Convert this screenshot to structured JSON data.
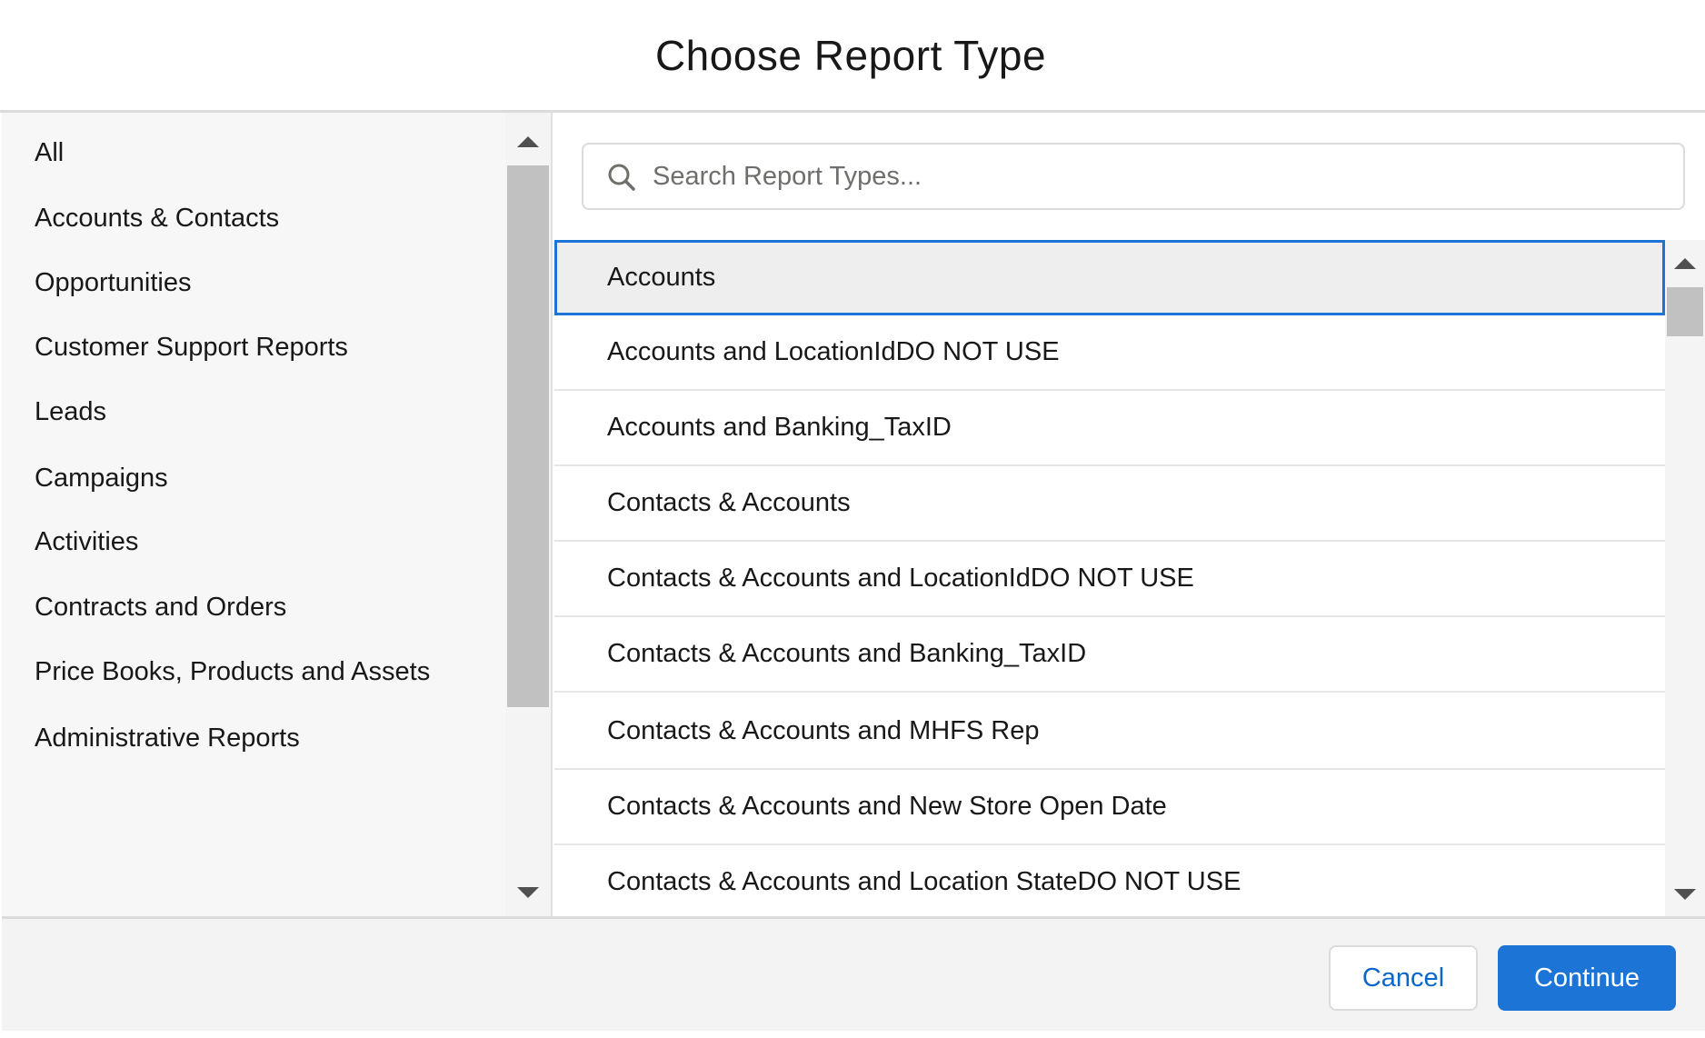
{
  "dialog": {
    "title": "Choose Report Type"
  },
  "categories": [
    {
      "label": "All"
    },
    {
      "label": "Accounts & Contacts"
    },
    {
      "label": "Opportunities"
    },
    {
      "label": "Customer Support Reports"
    },
    {
      "label": "Leads"
    },
    {
      "label": "Campaigns"
    },
    {
      "label": "Activities"
    },
    {
      "label": "Contracts and Orders"
    },
    {
      "label": "Price Books, Products and Assets"
    },
    {
      "label": "Administrative Reports"
    }
  ],
  "search": {
    "placeholder": "Search Report Types...",
    "value": ""
  },
  "report_types": [
    {
      "label": "Accounts",
      "selected": true
    },
    {
      "label": "Accounts and LocationIdDO NOT USE"
    },
    {
      "label": "Accounts and Banking_TaxID"
    },
    {
      "label": "Contacts & Accounts"
    },
    {
      "label": "Contacts & Accounts and LocationIdDO NOT USE"
    },
    {
      "label": "Contacts & Accounts and Banking_TaxID"
    },
    {
      "label": "Contacts & Accounts and MHFS Rep"
    },
    {
      "label": "Contacts & Accounts and New Store Open Date"
    },
    {
      "label": "Contacts & Accounts and Location StateDO NOT USE"
    }
  ],
  "footer": {
    "cancel_label": "Cancel",
    "continue_label": "Continue"
  },
  "colors": {
    "brand": "#1b74d6",
    "selected_row_bg": "#eeeeee",
    "border": "#dddbda"
  }
}
